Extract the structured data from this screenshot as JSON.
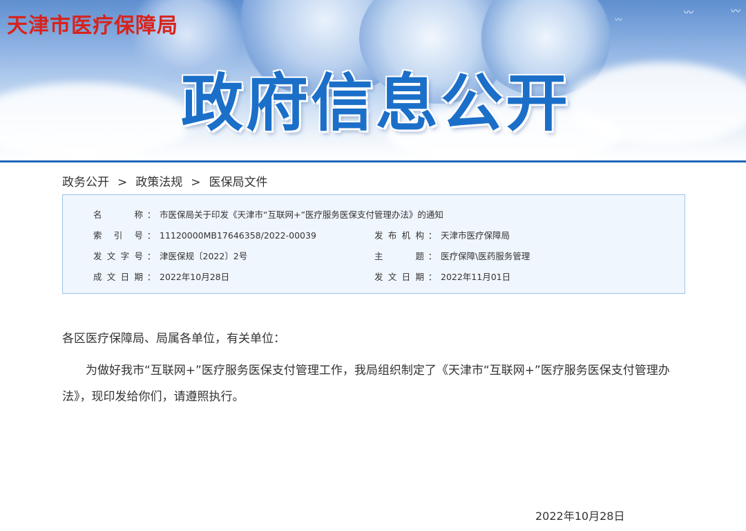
{
  "header": {
    "agency_logo": "天津市医疗保障局",
    "banner_title": "政府信息公开"
  },
  "breadcrumb": [
    {
      "label": "政务公开"
    },
    {
      "label": "政策法规"
    },
    {
      "label": "医保局文件"
    }
  ],
  "breadcrumb_separator": ">",
  "info": {
    "name_label": "名 称",
    "name_value": "市医保局关于印发《天津市“互联网+”医疗服务医保支付管理办法》的通知",
    "index_label": "索 引 号",
    "index_value": "11120000MB17646358/2022-00039",
    "publisher_label": "发 布 机 构",
    "publisher_value": "天津市医疗保障局",
    "doc_no_label": "发 文 字 号",
    "doc_no_value": "津医保规〔2022〕2号",
    "subject_label": "主 题",
    "subject_value": "医疗保障\\医药服务管理",
    "created_label": "成 文 日 期",
    "created_value": "2022年10月28日",
    "issued_label": "发 文 日 期",
    "issued_value": "2022年11月01日",
    "colon": "："
  },
  "body": {
    "salutation": "各区医疗保障局、局属各单位，有关单位：",
    "paragraph": "为做好我市“互联网+”医疗服务医保支付管理工作，我局组织制定了《天津市“互联网+”医疗服务医保支付管理办法》，现印发给你们，请遵照执行。",
    "date": "2022年10月28日"
  },
  "colors": {
    "agency_red": "#d7231c",
    "banner_blue": "#1b6fc8",
    "rule_blue": "#1f66b8",
    "info_bg": "#f0f6fd",
    "info_border": "#9cc3ea"
  }
}
